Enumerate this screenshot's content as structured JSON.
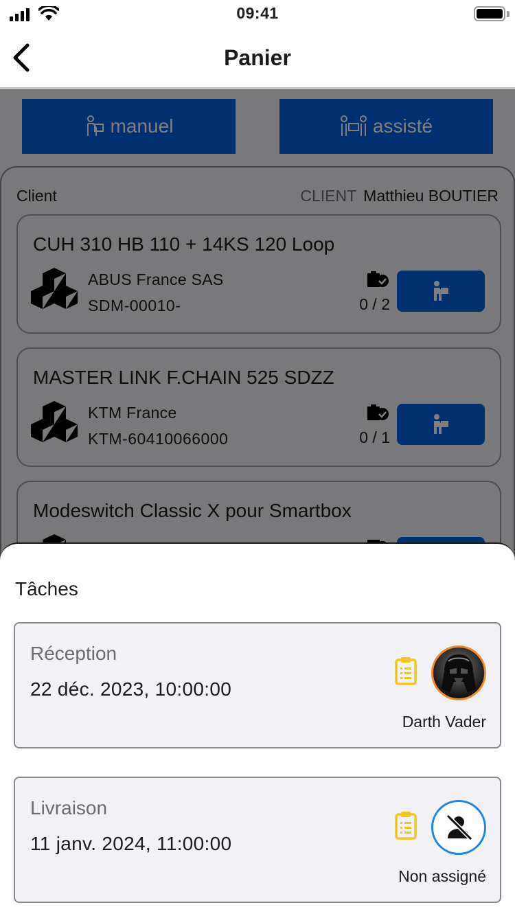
{
  "status": {
    "time": "09:41"
  },
  "nav": {
    "title": "Panier"
  },
  "modes": {
    "manual": "manuel",
    "assisted": "assisté"
  },
  "client": {
    "label": "Client",
    "tag": "CLIENT",
    "name": "Matthieu BOUTIER"
  },
  "items": [
    {
      "title": "CUH 310 HB 110 + 14KS 120 Loop",
      "brand": "ABUS France SAS",
      "sku": "SDM-00010-",
      "qty": "0 / 2"
    },
    {
      "title": "MASTER LINK F.CHAIN 525 SDZZ",
      "brand": "KTM France",
      "sku": "KTM-60410066000",
      "qty": "0 / 1"
    },
    {
      "title": "Modeswitch Classic X pour Smartbox",
      "brand": "",
      "sku": "",
      "qty": ""
    }
  ],
  "sheet": {
    "title": "Tâches",
    "tasks": [
      {
        "name": "Réception",
        "date": "22 déc. 2023, 10:00:00",
        "assignee": "Darth Vader",
        "avatar": "darth-vader-photo"
      },
      {
        "name": "Livraison",
        "date": "11 janv. 2024, 11:00:00",
        "assignee": "Non assigné",
        "avatar": "unassigned-user-icon"
      }
    ]
  },
  "colors": {
    "primary": "#0060df",
    "clipboard": "#f5c518",
    "avatar_ring": "#f08a24",
    "unassigned_ring": "#1f86e8"
  }
}
